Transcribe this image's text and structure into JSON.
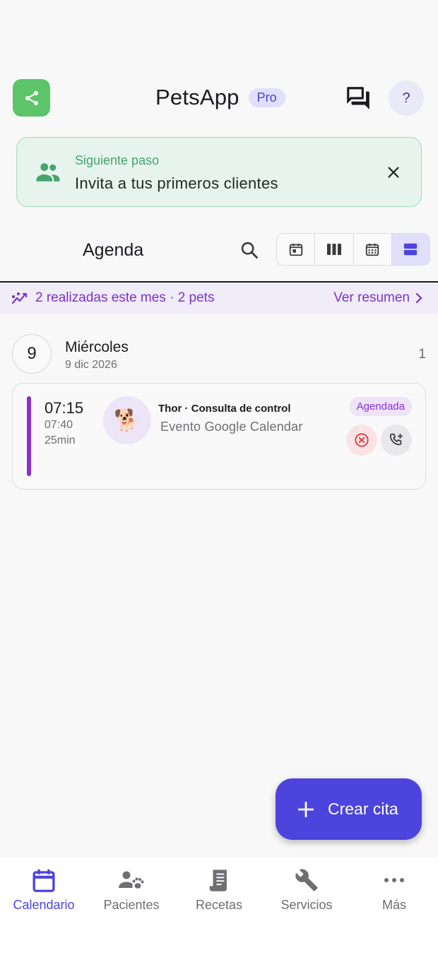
{
  "header": {
    "title": "PetsApp",
    "badge": "Pro",
    "help_label": "?"
  },
  "next_step": {
    "label": "Siguiente paso",
    "text": "Invita a tus primeros clientes"
  },
  "agenda": {
    "title": "Agenda",
    "views": [
      "day-view",
      "week-view",
      "month-view",
      "list-view"
    ],
    "selected_view": "list-view"
  },
  "stats": {
    "text": "2 realizadas este mes · 2 pets",
    "link": "Ver resumen"
  },
  "day": {
    "number": "9",
    "name": "Miércoles",
    "date": "9 dic 2026",
    "count": "1"
  },
  "appointment": {
    "start": "07:15",
    "end": "07:40",
    "duration": "25min",
    "avatar": "🐕",
    "title": "Thor · Consulta de control",
    "subtitle": "Evento Google Calendar",
    "status": "Agendada"
  },
  "fab": {
    "label": "Crear cita"
  },
  "nav": {
    "items": [
      {
        "label": "Calendario",
        "icon": "calendar-icon",
        "active": true
      },
      {
        "label": "Pacientes",
        "icon": "patients-icon",
        "active": false
      },
      {
        "label": "Recetas",
        "icon": "receipt-icon",
        "active": false
      },
      {
        "label": "Servicios",
        "icon": "wrench-icon",
        "active": false
      },
      {
        "label": "Más",
        "icon": "more-icon",
        "active": false
      }
    ]
  },
  "colors": {
    "accent": "#4c44dc",
    "share": "#5ec46a",
    "event": "#8a2ed6",
    "success": "#45a36e"
  }
}
